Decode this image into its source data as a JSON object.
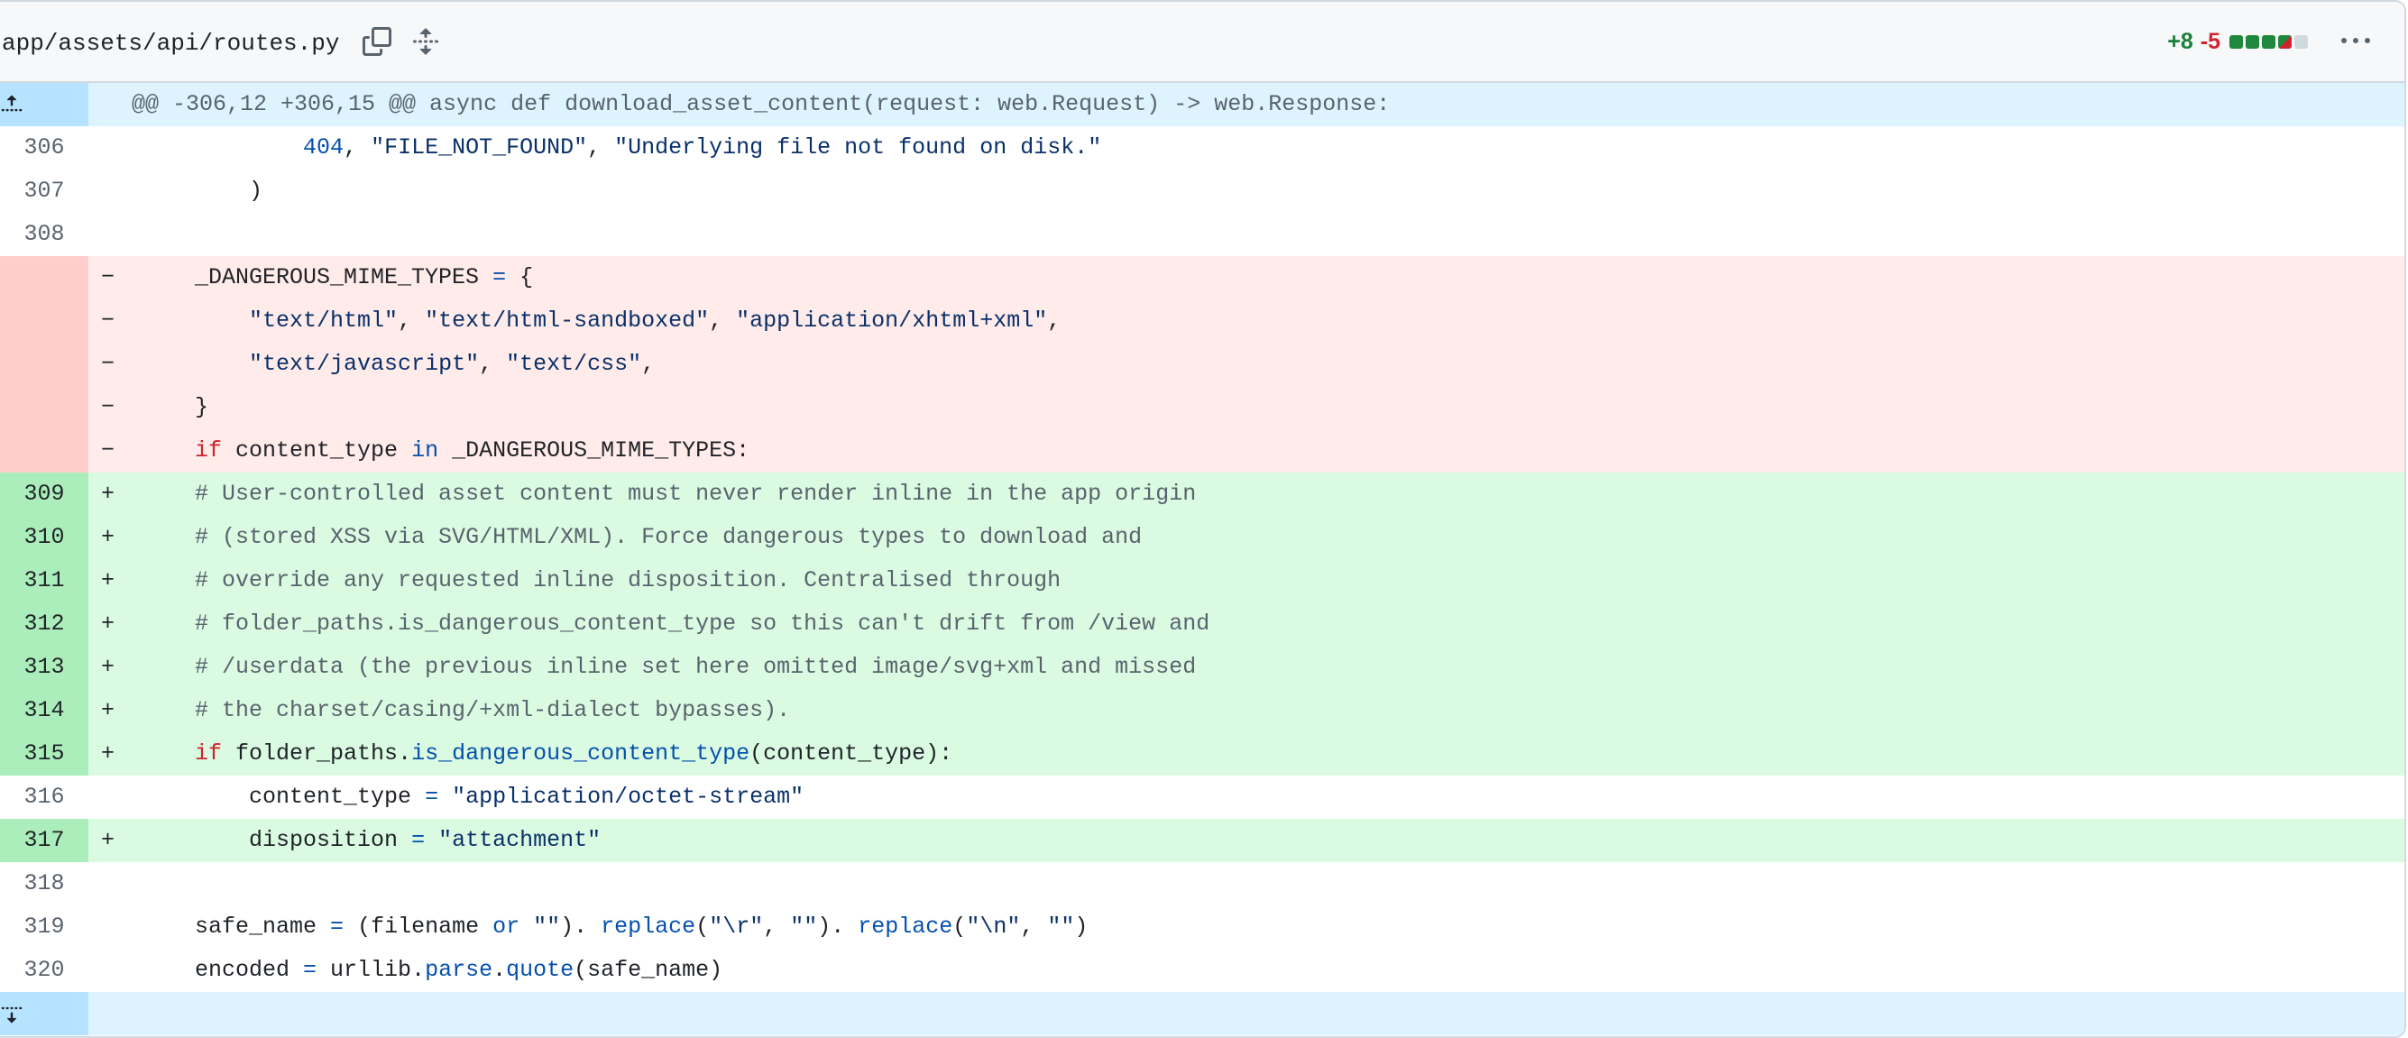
{
  "file": {
    "path": "app/assets/api/routes.py",
    "additions": "+8",
    "deletions": "-5",
    "diffstat_blocks": [
      "green",
      "green",
      "green",
      "green-red",
      "neutral"
    ]
  },
  "icons": {
    "copy": "copy-icon",
    "expand_all": "unfold-icon",
    "more": "kebab-horizontal-icon",
    "expand_up": "expand-up-icon",
    "expand_down": "expand-down-icon"
  },
  "colors": {
    "addition": "#1a7f37",
    "deletion": "#d1242f",
    "hunk_bg": "#ddf4ff"
  },
  "hunk_header": "@@ -306,12 +306,15 @@ async def download_asset_content(request: web.Request) -> web.Response:",
  "lines": [
    {
      "type": "ctx",
      "num": "306",
      "marker": "",
      "tokens": [
        [
          "",
          "            "
        ],
        [
          "numlit",
          "404"
        ],
        [
          "",
          ", "
        ],
        [
          "str",
          "\"FILE_NOT_FOUND\""
        ],
        [
          "",
          ", "
        ],
        [
          "str",
          "\"Underlying file not found on disk.\""
        ]
      ]
    },
    {
      "type": "ctx",
      "num": "307",
      "marker": "",
      "tokens": [
        [
          "",
          "        )"
        ]
      ]
    },
    {
      "type": "ctx",
      "num": "308",
      "marker": "",
      "tokens": [
        [
          "",
          ""
        ]
      ]
    },
    {
      "type": "del",
      "num": "",
      "marker": "−",
      "tokens": [
        [
          "",
          "    _DANGEROUS_MIME_TYPES "
        ],
        [
          "op",
          "="
        ],
        [
          "",
          " {"
        ]
      ]
    },
    {
      "type": "del",
      "num": "",
      "marker": "−",
      "tokens": [
        [
          "",
          "        "
        ],
        [
          "str",
          "\"text/html\""
        ],
        [
          "",
          ", "
        ],
        [
          "str",
          "\"text/html-sandboxed\""
        ],
        [
          "",
          ", "
        ],
        [
          "str",
          "\"application/xhtml+xml\""
        ],
        [
          "",
          ","
        ]
      ]
    },
    {
      "type": "del",
      "num": "",
      "marker": "−",
      "tokens": [
        [
          "",
          "        "
        ],
        [
          "str",
          "\"text/javascript\""
        ],
        [
          "",
          ", "
        ],
        [
          "str",
          "\"text/css\""
        ],
        [
          "",
          ","
        ]
      ]
    },
    {
      "type": "del",
      "num": "",
      "marker": "−",
      "tokens": [
        [
          "",
          "    }"
        ]
      ]
    },
    {
      "type": "del",
      "num": "",
      "marker": "−",
      "tokens": [
        [
          "",
          "    "
        ],
        [
          "kw",
          "if"
        ],
        [
          "",
          " content_type "
        ],
        [
          "op",
          "in"
        ],
        [
          "",
          " _DANGEROUS_MIME_TYPES:"
        ]
      ]
    },
    {
      "type": "add",
      "num": "309",
      "marker": "+",
      "tokens": [
        [
          "",
          "    "
        ],
        [
          "cm",
          "# User-controlled asset content must never render inline in the app origin"
        ]
      ]
    },
    {
      "type": "add",
      "num": "310",
      "marker": "+",
      "tokens": [
        [
          "",
          "    "
        ],
        [
          "cm",
          "# (stored XSS via SVG/HTML/XML). Force dangerous types to download and"
        ]
      ]
    },
    {
      "type": "add",
      "num": "311",
      "marker": "+",
      "tokens": [
        [
          "",
          "    "
        ],
        [
          "cm",
          "# override any requested inline disposition. Centralised through"
        ]
      ]
    },
    {
      "type": "add",
      "num": "312",
      "marker": "+",
      "tokens": [
        [
          "",
          "    "
        ],
        [
          "cm",
          "# folder_paths.is_dangerous_content_type so this can't drift from /view and"
        ]
      ]
    },
    {
      "type": "add",
      "num": "313",
      "marker": "+",
      "tokens": [
        [
          "",
          "    "
        ],
        [
          "cm",
          "# /userdata (the previous inline set here omitted image/svg+xml and missed"
        ]
      ]
    },
    {
      "type": "add",
      "num": "314",
      "marker": "+",
      "tokens": [
        [
          "",
          "    "
        ],
        [
          "cm",
          "# the charset/casing/+xml-dialect bypasses)."
        ]
      ]
    },
    {
      "type": "add",
      "num": "315",
      "marker": "+",
      "tokens": [
        [
          "",
          "    "
        ],
        [
          "kw",
          "if"
        ],
        [
          "",
          " folder_paths."
        ],
        [
          "fn",
          "is_dangerous_content_type"
        ],
        [
          "",
          "(content_type):"
        ]
      ]
    },
    {
      "type": "ctx",
      "num": "316",
      "marker": "",
      "tokens": [
        [
          "",
          "        content_type "
        ],
        [
          "op",
          "="
        ],
        [
          "",
          " "
        ],
        [
          "str",
          "\"application/octet-stream\""
        ]
      ]
    },
    {
      "type": "add",
      "num": "317",
      "marker": "+",
      "tokens": [
        [
          "",
          "        disposition "
        ],
        [
          "op",
          "="
        ],
        [
          "",
          " "
        ],
        [
          "str",
          "\"attachment\""
        ]
      ]
    },
    {
      "type": "ctx",
      "num": "318",
      "marker": "",
      "tokens": [
        [
          "",
          ""
        ]
      ]
    },
    {
      "type": "ctx",
      "num": "319",
      "marker": "",
      "tokens": [
        [
          "",
          "    safe_name "
        ],
        [
          "op",
          "="
        ],
        [
          "",
          " (filename "
        ],
        [
          "op",
          "or"
        ],
        [
          "",
          " "
        ],
        [
          "str",
          "\"\""
        ],
        [
          "",
          "). "
        ],
        [
          "fn",
          "replace"
        ],
        [
          "",
          "("
        ],
        [
          "str",
          "\"\\r\""
        ],
        [
          "",
          ", "
        ],
        [
          "str",
          "\"\""
        ],
        [
          "",
          "). "
        ],
        [
          "fn",
          "replace"
        ],
        [
          "",
          "("
        ],
        [
          "str",
          "\"\\n\""
        ],
        [
          "",
          ", "
        ],
        [
          "str",
          "\"\""
        ],
        [
          "",
          ")"
        ]
      ]
    },
    {
      "type": "ctx",
      "num": "320",
      "marker": "",
      "tokens": [
        [
          "",
          "    encoded "
        ],
        [
          "op",
          "="
        ],
        [
          "",
          " urllib."
        ],
        [
          "fn",
          "parse"
        ],
        [
          "",
          "."
        ],
        [
          "fn",
          "quote"
        ],
        [
          "",
          "(safe_name)"
        ]
      ]
    }
  ]
}
